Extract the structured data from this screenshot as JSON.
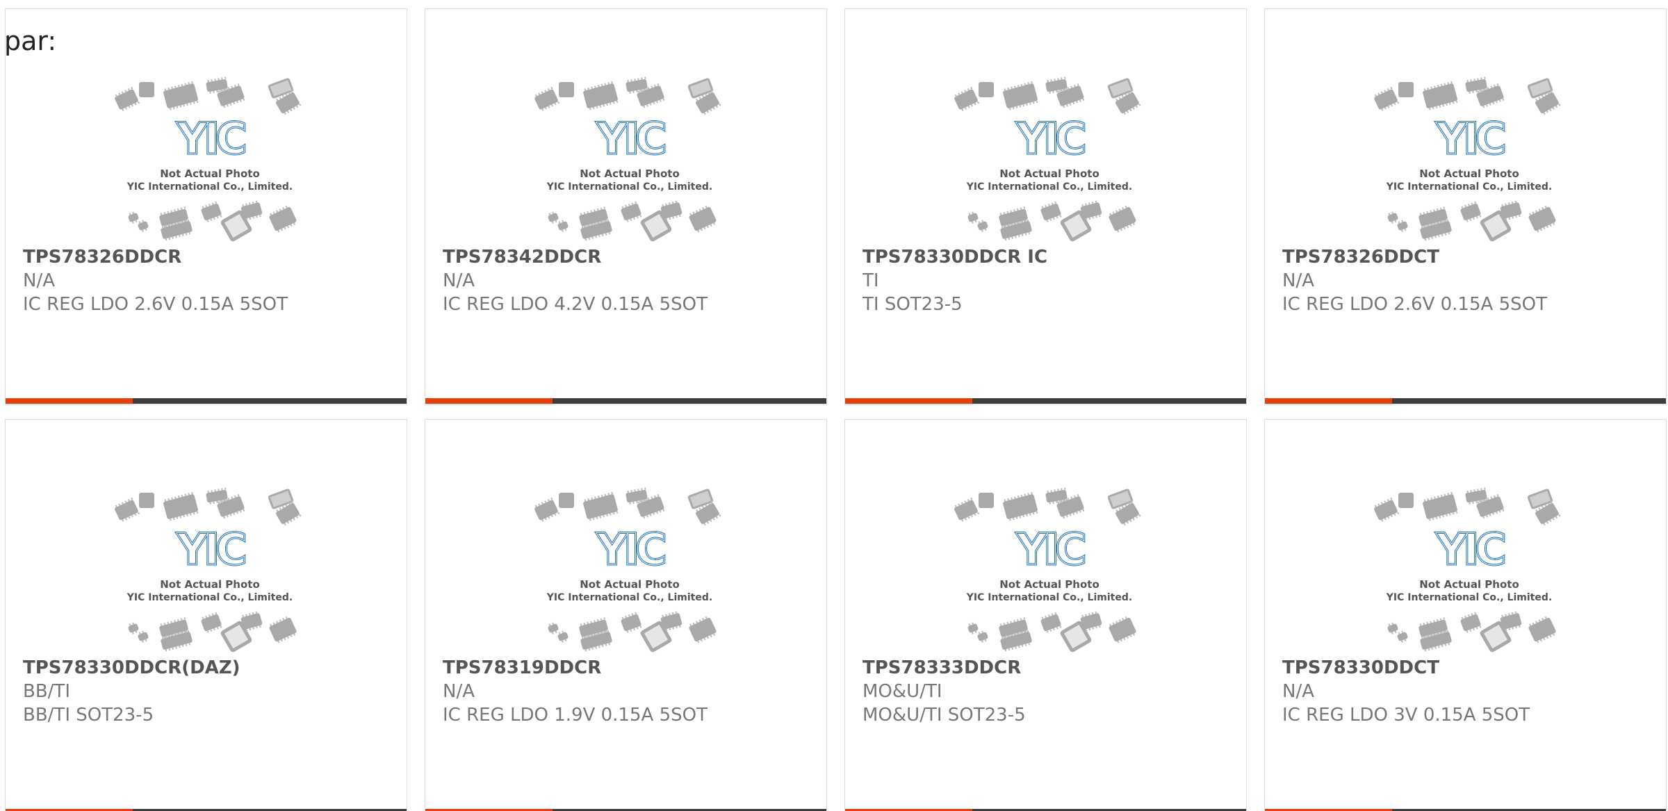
{
  "header": {
    "label": "par:"
  },
  "colors": {
    "accent": "#e8400c",
    "bar": "#3d3d3d",
    "logo_blue": "#1a6fb8",
    "chip_gray": "#a9a9a9"
  },
  "placeholder_image": {
    "line1": "Not Actual Photo",
    "line2": "YIC International Co., Limited.",
    "logo_text": "YIC"
  },
  "products": [
    {
      "part_number": "TPS78326DDCR",
      "manufacturer": "N/A",
      "description": "IC REG LDO 2.6V 0.15A 5SOT"
    },
    {
      "part_number": "TPS78342DDCR",
      "manufacturer": "N/A",
      "description": "IC REG LDO 4.2V 0.15A 5SOT"
    },
    {
      "part_number": "TPS78330DDCR IC",
      "manufacturer": "TI",
      "description": "TI SOT23-5"
    },
    {
      "part_number": "TPS78326DDCT",
      "manufacturer": "N/A",
      "description": "IC REG LDO 2.6V 0.15A 5SOT"
    },
    {
      "part_number": "TPS78330DDCR(DAZ)",
      "manufacturer": "BB/TI",
      "description": "BB/TI SOT23-5"
    },
    {
      "part_number": "TPS78319DDCR",
      "manufacturer": "N/A",
      "description": "IC REG LDO 1.9V 0.15A 5SOT"
    },
    {
      "part_number": "TPS78333DDCR",
      "manufacturer": "MO&U/TI",
      "description": "MO&U/TI SOT23-5"
    },
    {
      "part_number": "TPS78330DDCT",
      "manufacturer": "N/A",
      "description": "IC REG LDO 3V 0.15A 5SOT"
    }
  ]
}
